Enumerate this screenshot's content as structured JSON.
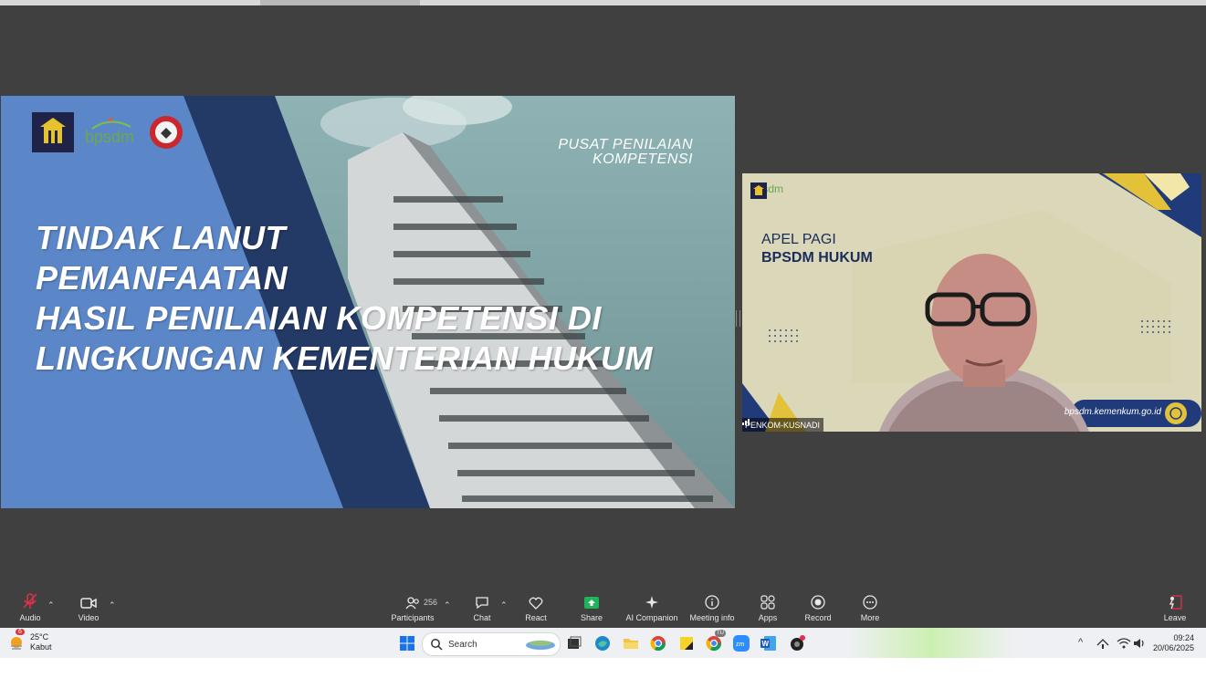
{
  "slide": {
    "header_line1": "PUSAT PENILAIAN",
    "header_line2": "KOMPETENSI",
    "title_lines": [
      "TINDAK LANUT",
      "PEMANFAATAN",
      "HASIL PENILAIAN KOMPETENSI DI",
      "LINGKUNGAN KEMENTERIAN HUKUM"
    ],
    "logo_bpsdm": "bpsdm",
    "logo_caption": "PENGAYOMAN"
  },
  "video": {
    "apel_line1": "APEL PAGI",
    "apel_line2": "BPSDM HUKUM",
    "logo_text": "bpsdm",
    "url": "bpsdm.kemenkum.go.id",
    "participant_name": "PENKOM-KUSNADI"
  },
  "toolbar": {
    "audio": "Audio",
    "video": "Video",
    "participants": "Participants",
    "participants_count": "256",
    "chat": "Chat",
    "react": "React",
    "share": "Share",
    "ai_companion": "AI Companion",
    "meeting_info": "Meeting info",
    "apps": "Apps",
    "record": "Record",
    "more": "More",
    "leave": "Leave"
  },
  "taskbar": {
    "weather_badge": "6",
    "temperature": "25°C",
    "condition": "Kabut",
    "search_placeholder": "Search",
    "chrome_badge": "TU",
    "time": "09:24",
    "date": "20/06/2025"
  },
  "colors": {
    "slide_blue": "#5b87c8",
    "slide_navy": "#243a66",
    "share_green": "#1fb45a",
    "leave_red": "#e0314b"
  }
}
